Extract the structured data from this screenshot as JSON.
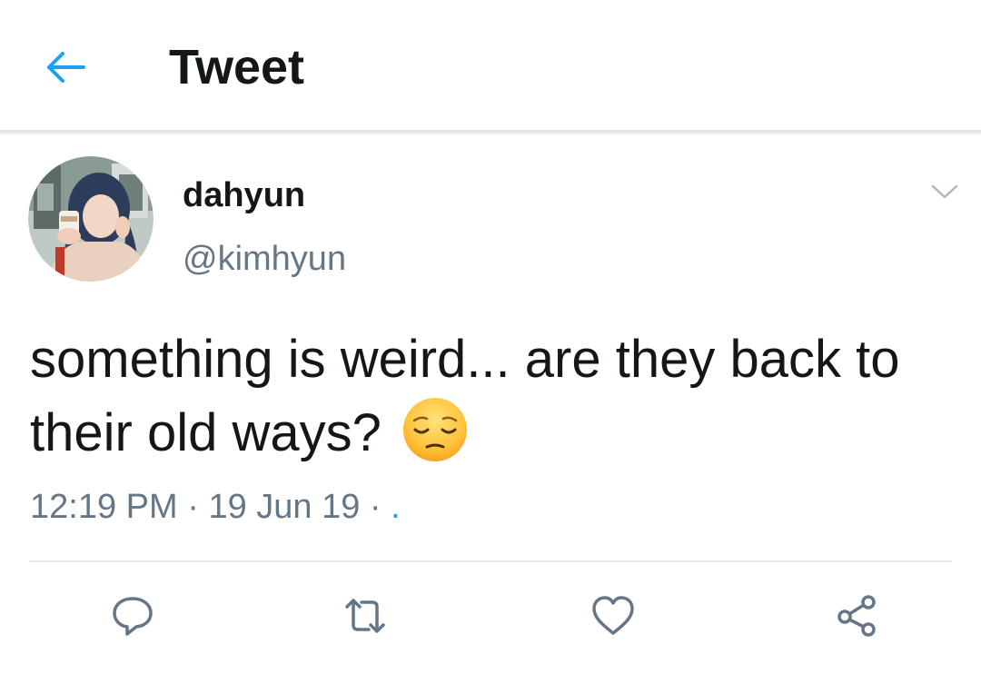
{
  "header": {
    "title": "Tweet",
    "back_icon": "arrow-left-icon",
    "accent_color": "#1da1f2"
  },
  "tweet": {
    "display_name": "dahyun",
    "handle": "@kimhyun",
    "text": "something is weird... are they back to their old ways?",
    "emoji": "pensive-face-emoji",
    "time": "12:19 PM",
    "date": "19 Jun 19",
    "separator": "·",
    "source": "."
  },
  "actions": {
    "reply_icon": "reply-icon",
    "retweet_icon": "retweet-icon",
    "like_icon": "heart-icon",
    "share_icon": "share-icon"
  },
  "colors": {
    "text_primary": "#14171a",
    "text_secondary": "#657786",
    "icon": "#657786",
    "divider": "#e6ecf0"
  }
}
